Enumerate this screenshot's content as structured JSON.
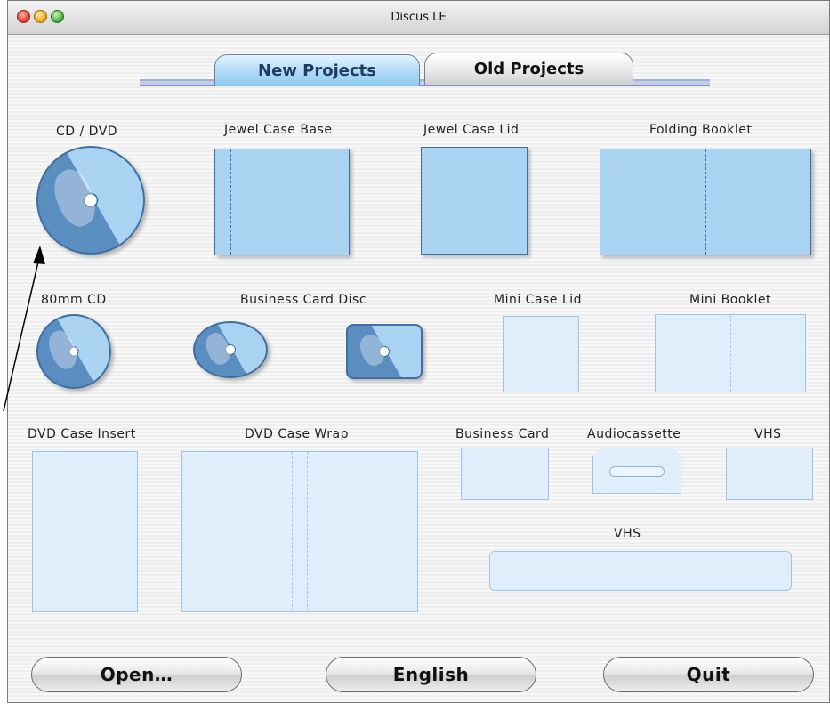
{
  "window": {
    "title": "Discus LE"
  },
  "tabs": {
    "new_projects": "New Projects",
    "old_projects": "Old Projects"
  },
  "projects": {
    "cd_dvd": "CD / DVD",
    "jewel_case_base": "Jewel Case Base",
    "jewel_case_lid": "Jewel Case Lid",
    "folding_booklet": "Folding Booklet",
    "mm80_cd": "80mm CD",
    "business_card_disc": "Business Card Disc",
    "mini_case_lid": "Mini Case Lid",
    "mini_booklet": "Mini Booklet",
    "dvd_case_insert": "DVD Case Insert",
    "dvd_case_wrap": "DVD Case Wrap",
    "business_card": "Business Card",
    "audiocassette": "Audiocassette",
    "vhs_top": "VHS",
    "vhs_spine": "VHS"
  },
  "buttons": {
    "open": "Open…",
    "language": "English",
    "quit": "Quit"
  },
  "colors": {
    "accent_dark": "#3f6fa0",
    "accent_fill": "#a9d3f1",
    "accent_light": "#dfeefa",
    "tab_active": "#a8d8f6"
  },
  "icons": [
    "close-icon",
    "minimize-icon",
    "zoom-icon",
    "cd-dvd-icon",
    "80mm-cd-icon",
    "business-card-disc-round-icon",
    "business-card-disc-rect-icon",
    "audiocassette-icon",
    "pointer-arrow-icon"
  ]
}
